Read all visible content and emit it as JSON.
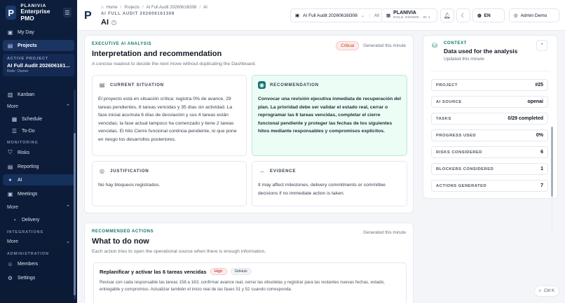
{
  "brand": {
    "name": "PLANIVIA",
    "sub": "Enterprise PMO"
  },
  "sidebar": {
    "my_day": "My Day",
    "projects": "Projects",
    "active_project_label": "ACTIVE PROJECT",
    "active_project_name": "AI Full Audit 202606161...",
    "active_project_role": "Role: Owner",
    "kanban": "Kanban",
    "more_1": "More",
    "schedule": "Schedule",
    "todo": "To-Do",
    "monitoring": "MONITORING",
    "risks": "Risks",
    "reporting": "Reporting",
    "ai": "AI",
    "meetings": "Meetings",
    "more_2": "More",
    "delivery": "Delivery",
    "integrations": "INTEGRATIONS",
    "more_3": "More",
    "administration": "ADMINISTRATION",
    "members": "Members",
    "settings": "Settings"
  },
  "header": {
    "crumbs": [
      "Home",
      "Projects",
      "AI Full Audit 20260616l308",
      "AI"
    ],
    "subtitle": "AI FULL AUDIT 202606161308",
    "title": "AI",
    "project_select": "AI Full Audit 20260616l308",
    "project_all": "All",
    "role_name": "PLANIVIA",
    "role_desc": "ROLE OWNER · ID 1",
    "lang": "EN",
    "user": "Admin Demo"
  },
  "executive": {
    "eyebrow": "EXECUTIVE AI ANALYSIS",
    "title": "Interpretation and recommendation",
    "desc": "A concise readout to decide the next move without duplicating the Dashboard.",
    "badge": "Critical",
    "generated": "Generated this minute",
    "current_label": "CURRENT SITUATION",
    "current_body": "El proyecto está en situación crítica: registra 0% de avance, 29 tareas pendientes, 6 tareas vencidas y 35 días sin actividad. La fase inicial acumula 6 días de desviación y sus 4 tareas están vencidas; la fase actual tampoco ha comenzado y tiene 2 tareas vencidas. El hito Cierre funcional continúa pendiente, lo que pone en riesgo los desarrollos posteriores.",
    "reco_label": "RECOMMENDATION",
    "reco_body": "Convocar una revisión ejecutiva inmediata de recuperación del plan. La prioridad debe ser validar el estado real, cerrar o reprogramar las 6 tareas vencidas, completar el cierre funcional pendiente y proteger las fechas de los siguientes hitos mediante responsables y compromisos explícitos.",
    "just_label": "JUSTIFICATION",
    "just_body": "No hay bloqueos registrados.",
    "evid_label": "EVIDENCE",
    "evid_body": "It may affect milestones, delivery commitments or committee decisions if no immediate action is taken."
  },
  "context": {
    "eyebrow": "CONTEXT",
    "title": "Data used for the analysis",
    "updated": "Updated this minute",
    "rows": [
      {
        "k": "PROJECT",
        "v": "#25"
      },
      {
        "k": "AI SOURCE",
        "v": "openai"
      },
      {
        "k": "TASKS",
        "v": "0/29 completed"
      },
      {
        "k": "PROGRESS USED",
        "v": "0%"
      },
      {
        "k": "RISKS CONSIDERED",
        "v": "6"
      },
      {
        "k": "BLOCKERS CONSIDERED",
        "v": "1"
      },
      {
        "k": "ACTIONS GENERATED",
        "v": "7"
      }
    ]
  },
  "actions": {
    "eyebrow": "RECOMMENDED ACTIONS",
    "title": "What to do now",
    "desc": "Each action tries to open the operational source when there is enough information.",
    "generated": "Generated this minute",
    "item_title": "Replanificar y activar las 6 tareas vencidas",
    "item_priority": "High",
    "item_source": "GitHub",
    "item_desc": "Revisar con cada responsable las tareas 158 a 163; confirmar avance real, cerrar las obsoletas y registrar para las restantes nuevas fechas, estado, entregable y compromiso. Actualizar también el inicio real de las fases 51 y 52 cuando corresponda."
  },
  "shortcut": "Ctrl K",
  "colors": {
    "accent": "#0f766e",
    "sidebar": "#0d1e3d",
    "critical": "#c2410c"
  }
}
